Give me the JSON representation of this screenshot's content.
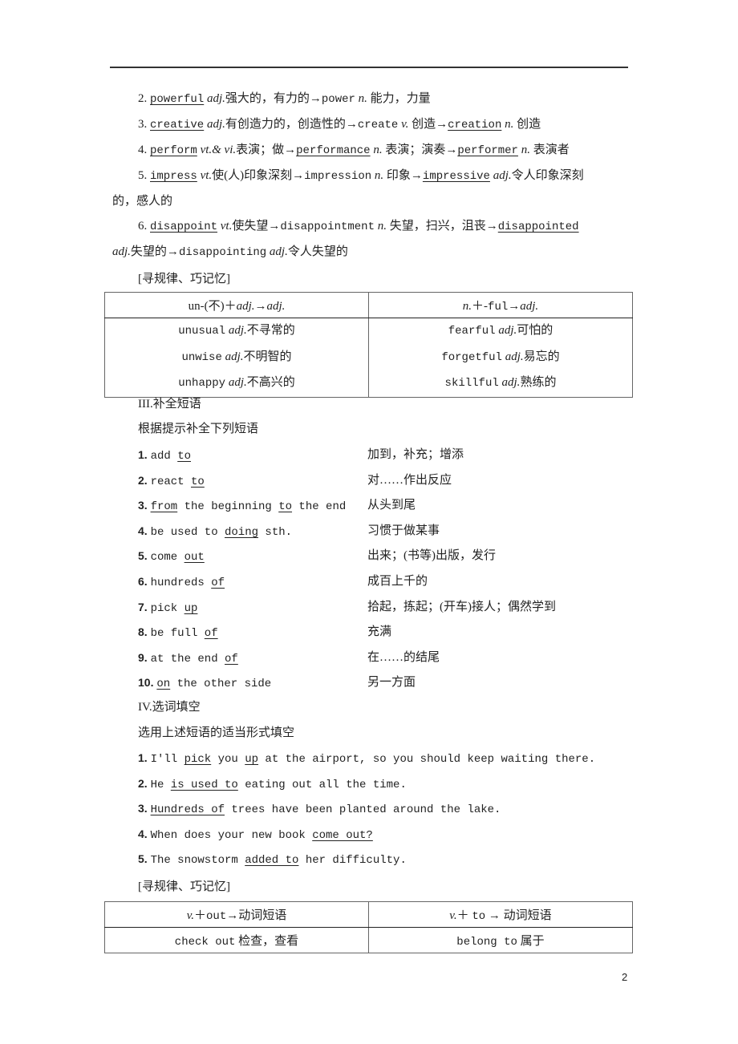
{
  "word_forms": [
    {
      "num": "2.",
      "parts": [
        {
          "t": "powerful",
          "u": true,
          "m": true
        },
        {
          "t": " "
        },
        {
          "t": "adj.",
          "i": true
        },
        {
          "t": "强大的，有力的→"
        },
        {
          "t": "power",
          "m": true
        },
        {
          "t": " "
        },
        {
          "t": "n.",
          "i": true
        },
        {
          "t": " 能力，力量"
        }
      ]
    },
    {
      "num": "3.",
      "parts": [
        {
          "t": "creative",
          "u": true,
          "m": true
        },
        {
          "t": " "
        },
        {
          "t": "adj.",
          "i": true
        },
        {
          "t": "有创造力的，创造性的→"
        },
        {
          "t": "create",
          "m": true
        },
        {
          "t": " "
        },
        {
          "t": "v.",
          "i": true
        },
        {
          "t": " 创造→"
        },
        {
          "t": "creation",
          "u": true,
          "m": true
        },
        {
          "t": " "
        },
        {
          "t": "n.",
          "i": true
        },
        {
          "t": " 创造"
        }
      ]
    },
    {
      "num": "4.",
      "parts": [
        {
          "t": "perform",
          "u": true,
          "m": true
        },
        {
          "t": " "
        },
        {
          "t": "vt.& vi.",
          "i": true
        },
        {
          "t": "表演；做→"
        },
        {
          "t": "performance",
          "u": true,
          "m": true
        },
        {
          "t": " "
        },
        {
          "t": "n.",
          "i": true
        },
        {
          "t": " 表演；演奏→"
        },
        {
          "t": "performer",
          "u": true,
          "m": true
        },
        {
          "t": " "
        },
        {
          "t": "n.",
          "i": true
        },
        {
          "t": " 表演者"
        }
      ]
    },
    {
      "num": "5.",
      "parts": [
        {
          "t": "impress",
          "u": true,
          "m": true
        },
        {
          "t": " "
        },
        {
          "t": "vt.",
          "i": true
        },
        {
          "t": "使(人)印象深刻→"
        },
        {
          "t": "impression",
          "m": true
        },
        {
          "t": " "
        },
        {
          "t": "n.",
          "i": true
        },
        {
          "t": " 印象→"
        },
        {
          "t": "impressive",
          "u": true,
          "m": true
        },
        {
          "t": " "
        },
        {
          "t": "adj.",
          "i": true
        },
        {
          "t": "令人印象深刻"
        }
      ],
      "cont": "的，感人的"
    },
    {
      "num": "6.",
      "parts": [
        {
          "t": "disappoint",
          "u": true,
          "m": true
        },
        {
          "t": " "
        },
        {
          "t": "vt.",
          "i": true
        },
        {
          "t": "使失望→"
        },
        {
          "t": "disappointment",
          "m": true
        },
        {
          "t": " "
        },
        {
          "t": "n.",
          "i": true
        },
        {
          "t": " 失望，扫兴，沮丧→"
        },
        {
          "t": "disappointed",
          "u": true,
          "m": true
        }
      ],
      "cont_parts": [
        {
          "t": "adj.",
          "i": true
        },
        {
          "t": "失望的→"
        },
        {
          "t": "disappointing",
          "m": true
        },
        {
          "t": " "
        },
        {
          "t": "adj.",
          "i": true
        },
        {
          "t": "令人失望的"
        }
      ]
    }
  ],
  "tip_label_1": "[寻规律、巧记忆]",
  "table1": {
    "headers": [
      [
        {
          "t": "un-(不)＋"
        },
        {
          "t": "adj.",
          "i": true
        },
        {
          "t": "→"
        },
        {
          "t": "adj.",
          "i": true
        }
      ],
      [
        {
          "t": "n.",
          "i": true
        },
        {
          "t": "＋-"
        },
        {
          "t": "ful",
          "m": true
        },
        {
          "t": "→"
        },
        {
          "t": "adj.",
          "i": true
        }
      ]
    ],
    "col1": [
      [
        {
          "t": "unusual",
          "m": true
        },
        {
          "t": " "
        },
        {
          "t": "adj.",
          "i": true
        },
        {
          "t": "不寻常的"
        }
      ],
      [
        {
          "t": "unwise",
          "m": true
        },
        {
          "t": " "
        },
        {
          "t": "adj.",
          "i": true
        },
        {
          "t": "不明智的"
        }
      ],
      [
        {
          "t": "unhappy",
          "m": true
        },
        {
          "t": " "
        },
        {
          "t": "adj.",
          "i": true
        },
        {
          "t": "不高兴的"
        }
      ]
    ],
    "col2": [
      [
        {
          "t": "fearful",
          "m": true
        },
        {
          "t": " "
        },
        {
          "t": "adj.",
          "i": true
        },
        {
          "t": "可怕的"
        }
      ],
      [
        {
          "t": "forgetful",
          "m": true
        },
        {
          "t": " "
        },
        {
          "t": "adj.",
          "i": true
        },
        {
          "t": "易忘的"
        }
      ],
      [
        {
          "t": "skillful",
          "m": true
        },
        {
          "t": " "
        },
        {
          "t": "adj.",
          "i": true
        },
        {
          "t": "熟练的"
        }
      ]
    ]
  },
  "section3": {
    "title": "III.补全短语",
    "instruction": "根据提示补全下列短语",
    "items": [
      {
        "num": "1.",
        "parts": [
          {
            "t": "add "
          },
          {
            "t": "to",
            "u": true
          }
        ],
        "gloss": "加到，补充；增添"
      },
      {
        "num": "2.",
        "parts": [
          {
            "t": "react "
          },
          {
            "t": "to",
            "u": true
          }
        ],
        "gloss": "对……作出反应"
      },
      {
        "num": "3.",
        "parts": [
          {
            "t": "from",
            "u": true
          },
          {
            "t": " the beginning "
          },
          {
            "t": "to",
            "u": true
          },
          {
            "t": " the end"
          }
        ],
        "gloss": "从头到尾"
      },
      {
        "num": "4.",
        "parts": [
          {
            "t": "be used to "
          },
          {
            "t": "doing",
            "u": true
          },
          {
            "t": " sth."
          }
        ],
        "gloss": "习惯于做某事"
      },
      {
        "num": "5.",
        "parts": [
          {
            "t": "come "
          },
          {
            "t": "out",
            "u": true
          }
        ],
        "gloss": "出来；(书等)出版，发行"
      },
      {
        "num": "6.",
        "parts": [
          {
            "t": "hundreds "
          },
          {
            "t": "of",
            "u": true
          }
        ],
        "gloss": "成百上千的"
      },
      {
        "num": "7.",
        "parts": [
          {
            "t": "pick "
          },
          {
            "t": "up",
            "u": true
          }
        ],
        "gloss": "拾起，拣起；(开车)接人；偶然学到"
      },
      {
        "num": "8.",
        "parts": [
          {
            "t": "be full "
          },
          {
            "t": "of",
            "u": true
          }
        ],
        "gloss": "充满"
      },
      {
        "num": "9.",
        "parts": [
          {
            "t": "at the end "
          },
          {
            "t": "of",
            "u": true
          }
        ],
        "gloss": "在……的结尾"
      },
      {
        "num": "10.",
        "parts": [
          {
            "t": "on",
            "u": true
          },
          {
            "t": " the other side"
          }
        ],
        "gloss": "另一方面"
      }
    ]
  },
  "section4": {
    "title": "IV.选词填空",
    "instruction": "选用上述短语的适当形式填空",
    "items": [
      {
        "num": "1.",
        "parts": [
          {
            "t": "I'll "
          },
          {
            "t": "pick",
            "u": true
          },
          {
            "t": " you "
          },
          {
            "t": "up",
            "u": true
          },
          {
            "t": " at the airport, so you should keep waiting there."
          }
        ]
      },
      {
        "num": "2.",
        "parts": [
          {
            "t": "He "
          },
          {
            "t": "is used to",
            "u": true
          },
          {
            "t": " eating out all the time."
          }
        ]
      },
      {
        "num": "3.",
        "parts": [
          {
            "t": "Hundreds of",
            "u": true
          },
          {
            "t": " trees have been planted around the lake."
          }
        ]
      },
      {
        "num": "4.",
        "parts": [
          {
            "t": "When does your new book "
          },
          {
            "t": "come out?",
            "u": true
          }
        ]
      },
      {
        "num": "5.",
        "parts": [
          {
            "t": "The snowstorm "
          },
          {
            "t": "added to",
            "u": true
          },
          {
            "t": " her difficulty."
          }
        ]
      }
    ]
  },
  "tip_label_2": "[寻规律、巧记忆]",
  "table2": {
    "headers": [
      [
        {
          "t": "v.",
          "i": true
        },
        {
          "t": "＋"
        },
        {
          "t": "out",
          "m": true
        },
        {
          "t": "→动词短语"
        }
      ],
      [
        {
          "t": "v.",
          "i": true
        },
        {
          "t": "＋ "
        },
        {
          "t": "to",
          "m": true
        },
        {
          "t": " → 动词短语"
        }
      ]
    ],
    "row": [
      [
        {
          "t": "check out",
          "m": true
        },
        {
          "t": " 检查，查看"
        }
      ],
      [
        {
          "t": "belong to",
          "m": true
        },
        {
          "t": " 属于"
        }
      ]
    ]
  },
  "page_number": "2"
}
